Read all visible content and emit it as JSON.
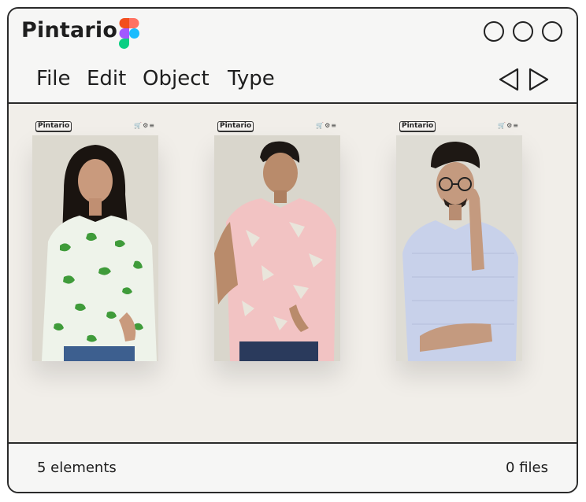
{
  "app": {
    "title": "Pintario",
    "logo_icon": "figma-icon"
  },
  "window_controls": [
    "window-button-1",
    "window-button-2",
    "window-button-3"
  ],
  "menu": {
    "items": [
      "File",
      "Edit",
      "Object",
      "Type"
    ]
  },
  "nav": {
    "back_icon": "triangle-left-icon",
    "forward_icon": "triangle-right-icon"
  },
  "cards": [
    {
      "brand": "Pintario",
      "icons": "cart gear menu",
      "shirt_color": "#7ec86a",
      "background": "#dcd9cf"
    },
    {
      "brand": "Pintario",
      "icons": "cart gear menu",
      "shirt_color": "#f2c3c3",
      "background": "#d9d6cc"
    },
    {
      "brand": "Pintario",
      "icons": "cart gear menu",
      "shirt_color": "#c8d1ea",
      "background": "#dedcd4"
    }
  ],
  "status": {
    "elements": "5 elements",
    "files": "0 files"
  },
  "colors": {
    "border": "#2a2a2a",
    "canvas": "#f1eee9",
    "chrome": "#f6f6f5"
  }
}
